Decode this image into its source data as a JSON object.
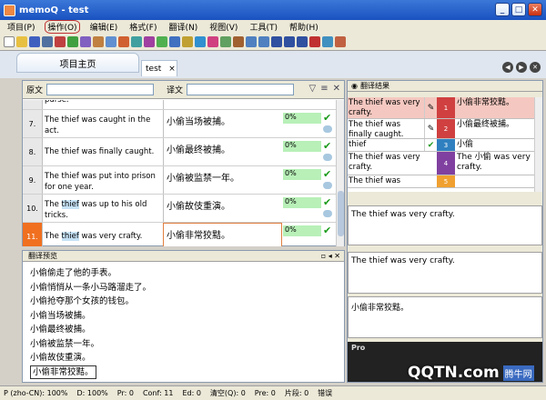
{
  "title": "memoQ - test",
  "menu": [
    "项目(P)",
    "操作(O)",
    "编辑(E)",
    "格式(F)",
    "翻译(N)",
    "视图(V)",
    "工具(T)",
    "帮助(H)"
  ],
  "tabs": {
    "home": "项目主页",
    "doc": "test"
  },
  "filter": {
    "source_label": "原文",
    "target_label": "译文"
  },
  "rows": [
    {
      "num": "",
      "src": "purse.",
      "tgt": "",
      "pct": ""
    },
    {
      "num": "7.",
      "src": "The thief was caught in the act.",
      "tgt": "小偷当场被捕。",
      "pct": "0%"
    },
    {
      "num": "8.",
      "src": "The thief was finally caught.",
      "tgt": "小偷最终被捕。",
      "pct": "0%"
    },
    {
      "num": "9.",
      "src": "The thief was put into prison for one year.",
      "tgt": "小偷被监禁一年。",
      "pct": "0%"
    },
    {
      "num": "10.",
      "src_a": "The ",
      "src_hl": "thief",
      "src_b": " was up to his old tricks.",
      "tgt": "小偷故伎重演。",
      "pct": "0%"
    },
    {
      "num": "11.",
      "src_a": "The ",
      "src_hl": "thief",
      "src_b": " was very crafty.",
      "tgt": "小偷非常狡黠。",
      "pct": "0%"
    }
  ],
  "preview": {
    "title": "翻译预览",
    "lines": [
      "小偷偷走了他的手表。",
      "小偷悄悄从一条小马路溜走了。",
      "小偷抢夺那个女孩的钱包。",
      "小偷当场被捕。",
      "小偷最终被捕。",
      "小偷被监禁一年。",
      "小偷故伎重演。",
      "小偷非常狡黠。"
    ]
  },
  "results": {
    "title": "翻译结果",
    "items": [
      {
        "src": "The thief was very crafty.",
        "n": "1",
        "tgt": "小偷非常狡黠。",
        "color": "#d04040"
      },
      {
        "src": "The thief was finally caught.",
        "n": "2",
        "tgt": "小偷最终被捕。",
        "color": "#d04040"
      },
      {
        "src": "thief",
        "n": "3",
        "tgt": "小偷",
        "color": "#3080c0"
      },
      {
        "src": "The thief was very crafty.",
        "n": "4",
        "tgt": "The 小偷 was very crafty.",
        "color": "#8040a0"
      },
      {
        "src": "The thief was",
        "n": "5",
        "tgt": "",
        "color": "#f0a030"
      }
    ],
    "box1": "The thief was very crafty.",
    "box2": "The thief was very crafty.",
    "box3": "小偷非常狡黠。",
    "pro_title": "Pro"
  },
  "status": [
    "P (zho-CN): 100%",
    "D: 100%",
    "Pr: 0",
    "Conf: 11",
    "Ed: 0",
    "清空(Q): 0",
    "Pre: 0",
    "片段: 0",
    "错误"
  ],
  "watermark": {
    "logo": "QQTN.com",
    "cn": "腾牛网"
  }
}
